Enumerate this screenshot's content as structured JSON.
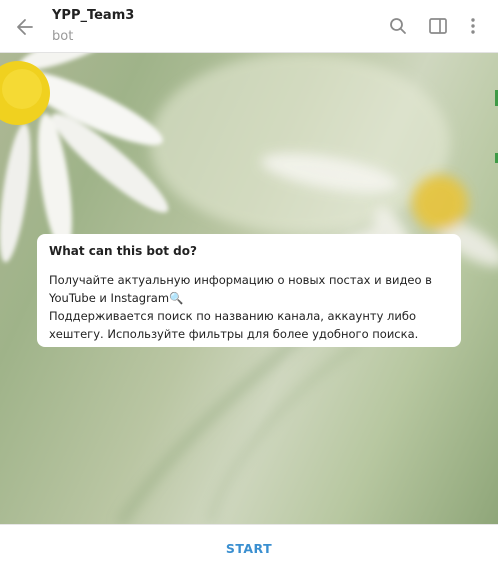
{
  "header": {
    "title": "YPP_Team3",
    "subtitle": "bot",
    "icons": [
      "back-arrow-icon",
      "search-icon",
      "sidebar-toggle-icon",
      "more-vertical-icon"
    ]
  },
  "info_card": {
    "title": "What can this bot do?",
    "text": "Получайте актуальную информацию о новых постах и видео в YouTube и Instagram🔍\nПоддерживается поиск по названию канала, аккаунту либо хештегу. Используйте фильтры для более удобного поиска."
  },
  "footer": {
    "start_label": "START"
  },
  "colors": {
    "accent": "#3a8fd0",
    "icon": "#8a8a8a",
    "title_text": "#222222",
    "subtitle_text": "#999999"
  }
}
